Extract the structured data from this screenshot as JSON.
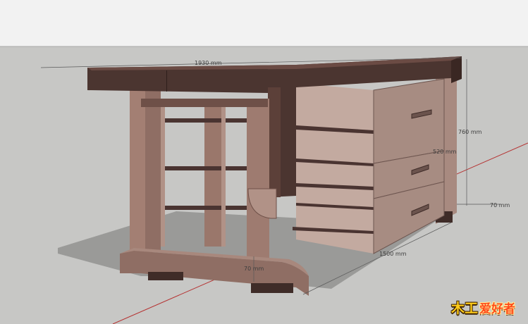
{
  "colors": {
    "sky": "#f2f2f2",
    "ground": "#c7c7c5",
    "top_dark": "#4b3530",
    "leg_dark": "#5a3d36",
    "wood_light": "#b19287",
    "wood_mid": "#8f6e64",
    "drawer_front": "#c3aaa0",
    "drawer_side": "#a78c82",
    "stripe": "#4a3431",
    "brand_accent": "#ff4a1a",
    "section_line": "#b53030"
  },
  "dimensions": {
    "width_label": "1930 mm",
    "height_label": "760 mm",
    "depth_label": "520 mm",
    "cabinet_label": "1500 mm",
    "foot_label": "70 mm",
    "base_label": "70 mm"
  },
  "watermark": {
    "mark": "木工",
    "text": "爱好者"
  },
  "model": {
    "drawer_handles": [
      "drawer-1-handle",
      "drawer-2-handle",
      "drawer-3-handle"
    ]
  }
}
